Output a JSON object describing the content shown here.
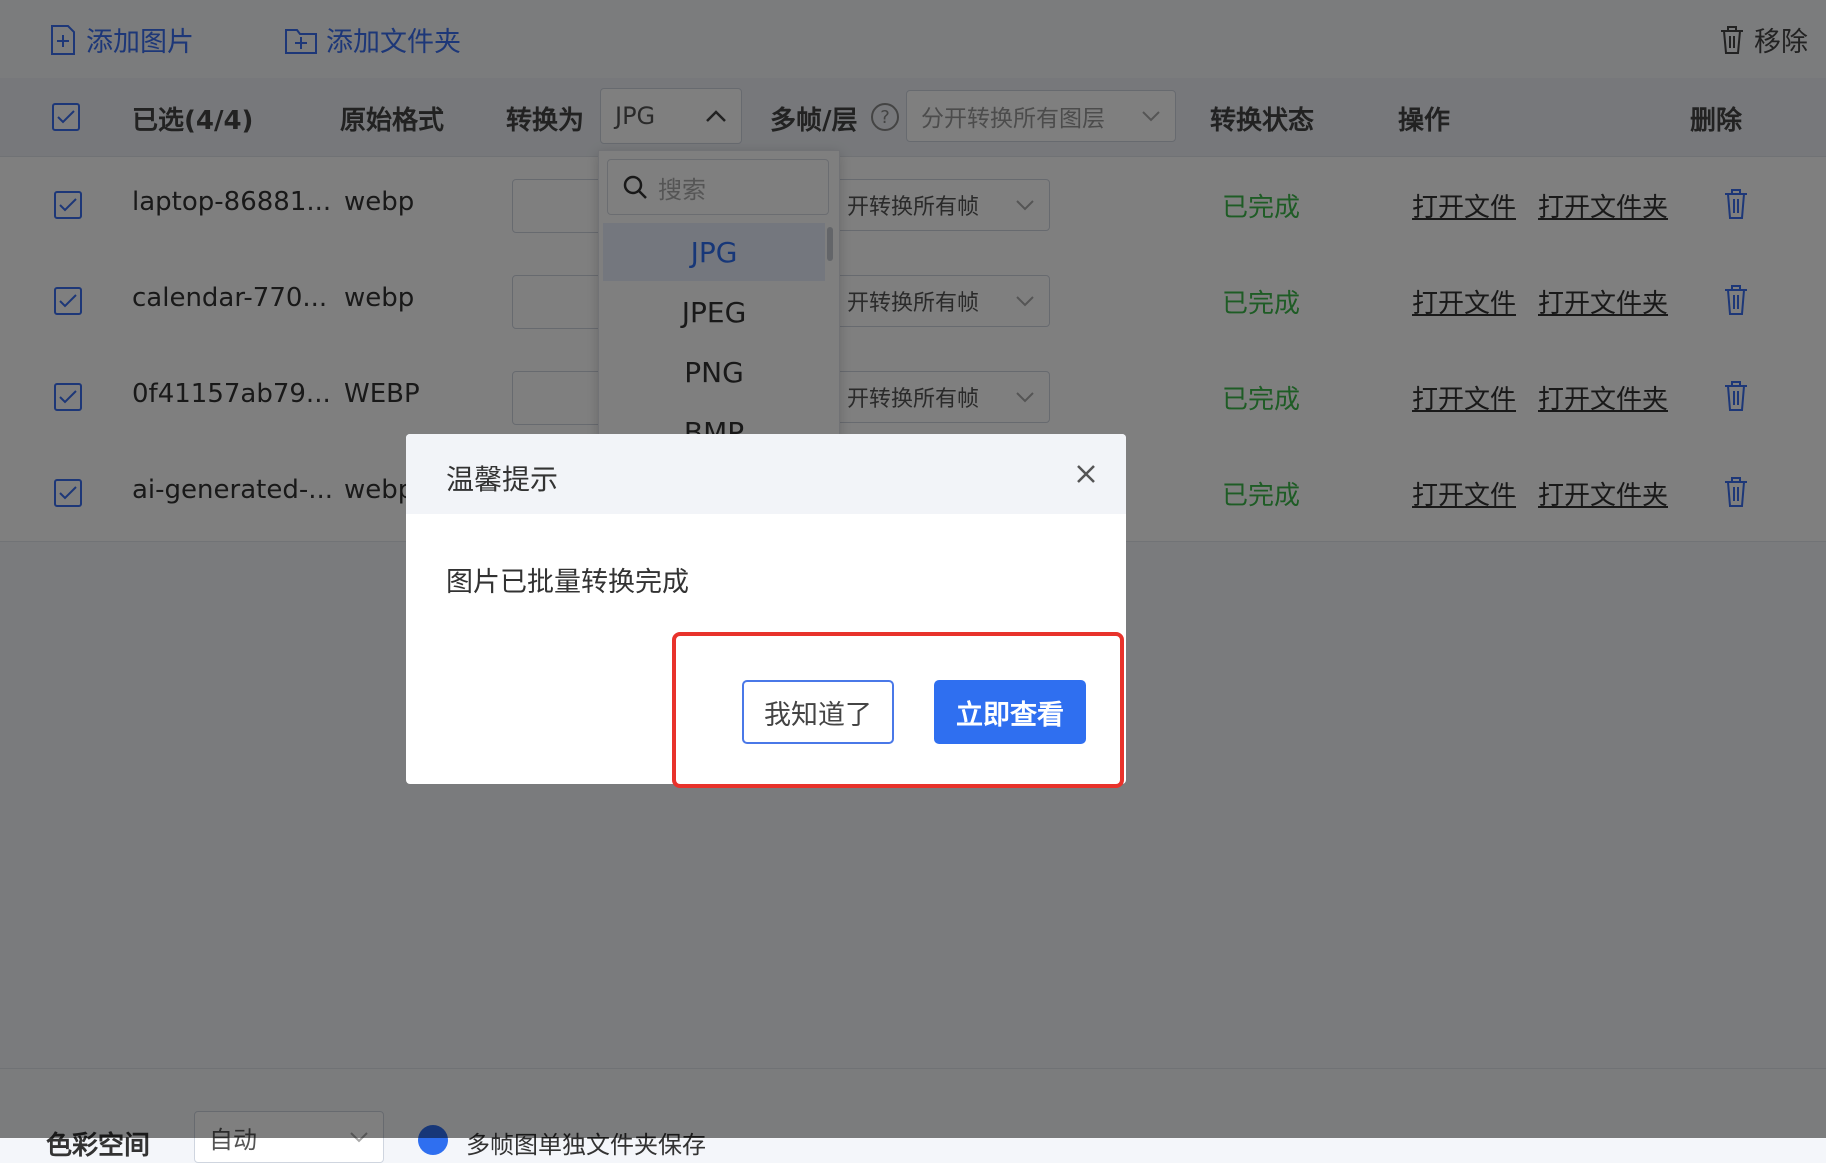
{
  "toolbar": {
    "add_image": "添加图片",
    "add_folder": "添加文件夹",
    "remove": "移除"
  },
  "header": {
    "selected": "已选(4/4)",
    "original_format": "原始格式",
    "convert_to": "转换为",
    "convert_value": "JPG",
    "multi_frame": "多帧/层",
    "multi_frame_value": "分开转换所有图层",
    "status": "转换状态",
    "actions": "操作",
    "delete": "删除"
  },
  "rows": [
    {
      "name": "laptop-86881...",
      "format": "webp",
      "frames": "开转换所有帧",
      "status": "已完成",
      "open_file": "打开文件",
      "open_folder": "打开文件夹"
    },
    {
      "name": "calendar-770...",
      "format": "webp",
      "frames": "开转换所有帧",
      "status": "已完成",
      "open_file": "打开文件",
      "open_folder": "打开文件夹"
    },
    {
      "name": "0f41157ab79...",
      "format": "WEBP",
      "frames": "开转换所有帧",
      "status": "已完成",
      "open_file": "打开文件",
      "open_folder": "打开文件夹"
    },
    {
      "name": "ai-generated-...",
      "format": "webp",
      "frames": "",
      "status": "已完成",
      "open_file": "打开文件",
      "open_folder": "打开文件夹"
    }
  ],
  "dropdown": {
    "search_placeholder": "搜索",
    "options": [
      "JPG",
      "JPEG",
      "PNG",
      "BMP"
    ],
    "selected": "JPG"
  },
  "modal": {
    "title": "温馨提示",
    "message": "图片已批量转换完成",
    "ok_button": "我知道了",
    "view_button": "立即查看"
  },
  "bottom": {
    "label": "色彩空间",
    "select_value": "自动",
    "option_text": "多帧图单独文件夹保存"
  },
  "colors": {
    "accent": "#2f6ff0",
    "success": "#3db84a",
    "highlight": "#e8322b"
  }
}
